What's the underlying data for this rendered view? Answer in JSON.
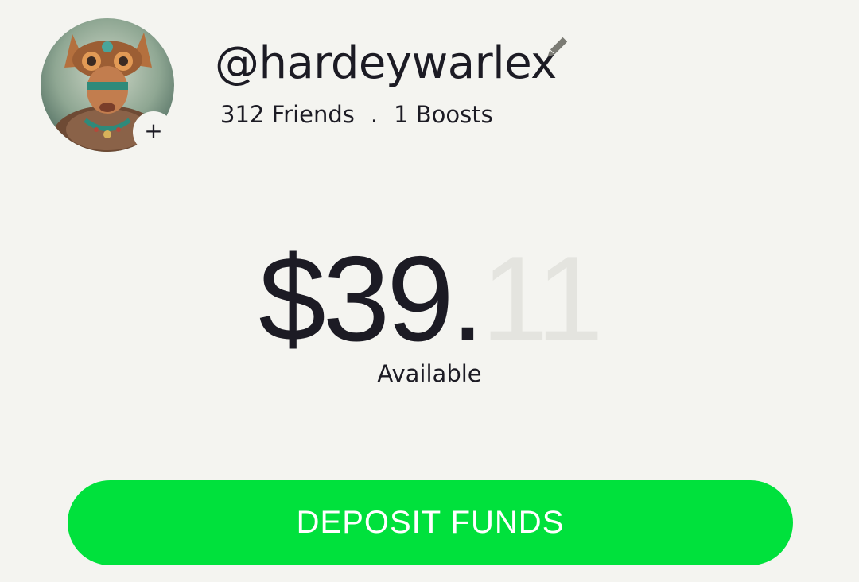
{
  "profile": {
    "username": "@hardeywarlex",
    "friends": "312 Friends",
    "separator": ".",
    "boosts": "1 Boosts",
    "avatar_icon": "avatar-image",
    "add_label": "+",
    "edit_icon": "pencil-icon"
  },
  "balance": {
    "dollars": "$39.",
    "cents": "11",
    "label": "Available"
  },
  "actions": {
    "deposit_label": "DEPOSIT FUNDS"
  },
  "colors": {
    "background": "#f4f4f0",
    "text": "#1c1b24",
    "accent_green": "#00e13c",
    "cents_faded": "#e4e4df",
    "edit_icon": "#7b7b74"
  }
}
